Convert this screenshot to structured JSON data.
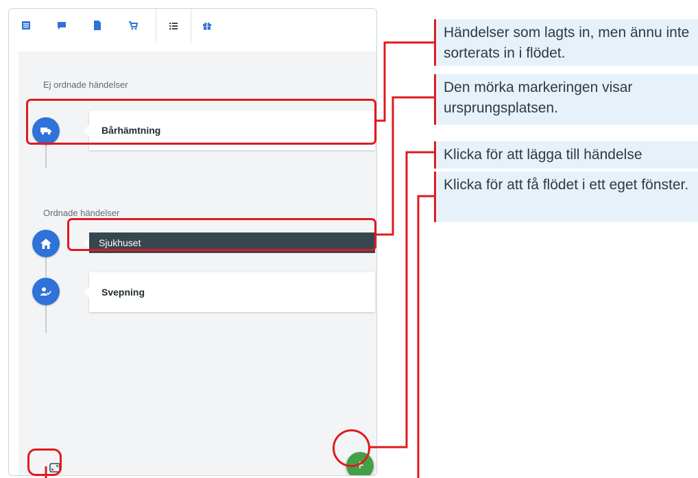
{
  "tabs": [
    {
      "icon": "list-detail-icon"
    },
    {
      "icon": "chat-icon"
    },
    {
      "icon": "document-icon"
    },
    {
      "icon": "cart-icon"
    },
    {
      "icon": "timeline-list-icon",
      "active": true
    },
    {
      "icon": "gift-icon"
    }
  ],
  "unordered": {
    "title": "Ej ordnade händelser",
    "items": [
      {
        "label": "Bårhämtning",
        "icon": "truck-icon"
      }
    ]
  },
  "ordered": {
    "title": "Ordnade händelser",
    "items": [
      {
        "label": "Sjukhuset",
        "icon": "home-icon",
        "highlighted": true
      },
      {
        "label": "Svepning",
        "icon": "person-check-icon"
      }
    ]
  },
  "buttons": {
    "add_label": "+",
    "expand_icon": "expand-window-icon"
  },
  "callouts": [
    "Händelser som lagts in, men ännu inte sorterats in i flödet.",
    "Den mörka markeringen visar ursprungsplatsen.",
    "Klicka för att lägga till händelse",
    "Klicka för att få flödet i ett eget fönster."
  ],
  "colors": {
    "accent_blue": "#2f72d8",
    "fab_green": "#43a047",
    "highlight_red": "#e0181f",
    "callout_bg": "#e7f1fa",
    "dark_card": "#37474f"
  }
}
